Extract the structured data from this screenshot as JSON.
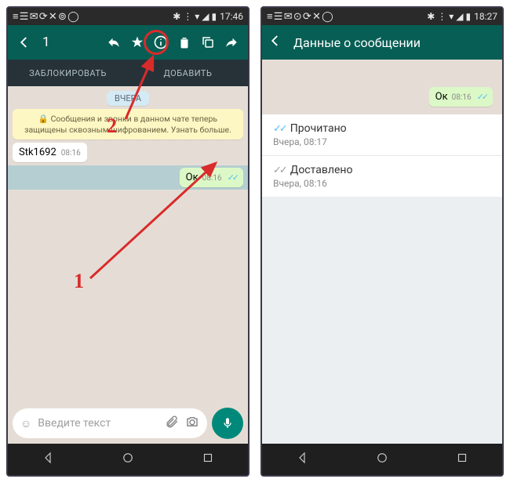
{
  "left": {
    "status": {
      "time": "17:46"
    },
    "appbar": {
      "count": "1"
    },
    "tabs": {
      "block": "ЗАБЛОКИРОВАТЬ",
      "add": "ДОБАВИТЬ"
    },
    "chat": {
      "date_label": "ВЧЕРА",
      "encryption_banner": "🔒 Сообщения и звонки в данном чате теперь защищены сквозным шифрованием. Узнать больше.",
      "incoming": {
        "text": "Stk1692",
        "time": "08:16"
      },
      "outgoing": {
        "text": "Ок",
        "time": "08:16"
      }
    },
    "input": {
      "placeholder": "Введите текст"
    },
    "annotations": {
      "label1": "1",
      "label2": "2"
    }
  },
  "right": {
    "status": {
      "time": "18:27"
    },
    "appbar": {
      "title": "Данные о сообщении"
    },
    "preview": {
      "text": "Ок",
      "time": "08:16"
    },
    "rows": {
      "read": {
        "label": "Прочитано",
        "time": "Вчера, 08:17"
      },
      "delivered": {
        "label": "Доставлено",
        "time": "Вчера, 08:16"
      }
    }
  }
}
